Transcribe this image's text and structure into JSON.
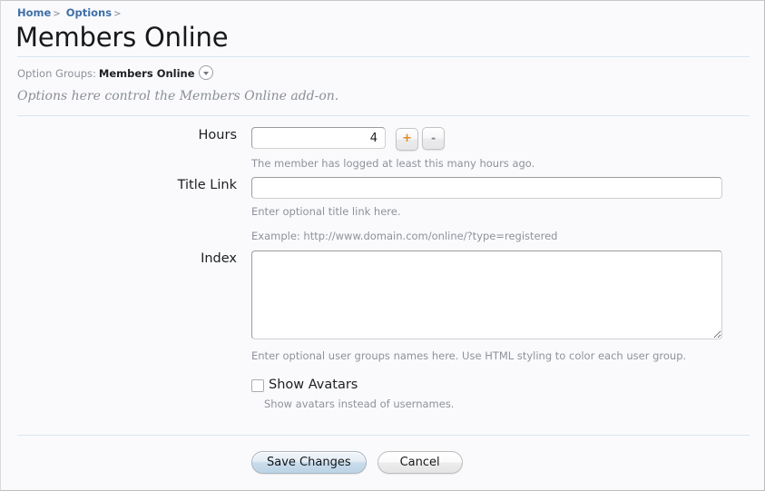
{
  "breadcrumb": {
    "items": [
      {
        "label": "Home",
        "separator": ">"
      },
      {
        "label": "Options",
        "separator": ">"
      }
    ]
  },
  "header": {
    "title": "Members Online"
  },
  "option_groups": {
    "label": "Option Groups:",
    "value": "Members Online",
    "dropdown_icon": "chevron-down-circle-icon"
  },
  "intro": {
    "text": "Options here control the Members Online add-on."
  },
  "form": {
    "hours": {
      "label": "Hours",
      "value": "4",
      "placeholder": "",
      "increment_label": "+",
      "decrement_label": "-",
      "hint": "The member has logged at least this many hours ago."
    },
    "title_link": {
      "label": "Title Link",
      "value": "",
      "placeholder": "",
      "hint": "Enter optional title link here.",
      "example": "Example: http://www.domain.com/online/?type=registered"
    },
    "index": {
      "label": "Index",
      "value": "",
      "placeholder": "",
      "hint": "Enter optional user groups names here. Use HTML styling to color each user group."
    },
    "show_avatars": {
      "label": "Show Avatars",
      "checked": false,
      "hint": "Show avatars instead of usernames."
    }
  },
  "actions": {
    "save_label": "Save Changes",
    "cancel_label": "Cancel"
  },
  "colors": {
    "page_background": "#fafafc",
    "link": "#3f6fa8",
    "divider": "#d6e8f2",
    "hint_text": "#8d929a",
    "title_text": "#16181a",
    "plus_button": "#e08a2a",
    "primary_button": "#bcd4e6"
  }
}
